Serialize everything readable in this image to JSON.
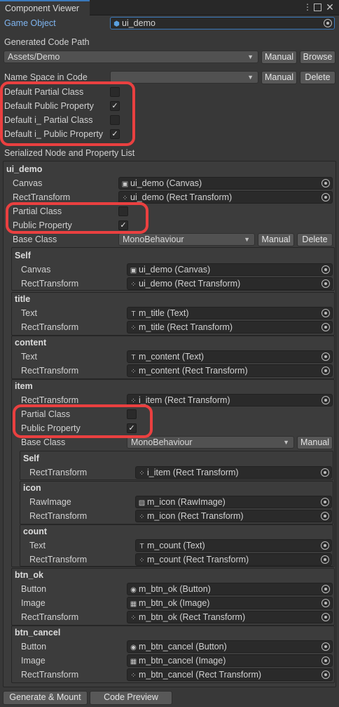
{
  "window": {
    "tab_title": "Component Viewer"
  },
  "game_object": {
    "label": "Game Object",
    "value": "ui_demo"
  },
  "code_path": {
    "label": "Generated Code Path",
    "value": "Assets/Demo",
    "manual": "Manual",
    "browse": "Browse"
  },
  "namespace": {
    "label": "Name Space in Code",
    "value": "",
    "manual": "Manual",
    "delete": "Delete"
  },
  "defaults": [
    {
      "label": "Default Partial Class",
      "checked": false
    },
    {
      "label": "Default Public Property",
      "checked": true
    },
    {
      "label": "Default i_ Partial Class",
      "checked": false
    },
    {
      "label": "Default i_ Public Property",
      "checked": true
    }
  ],
  "check_mark": "✓",
  "serialized_title": "Serialized Node and Property List",
  "root": {
    "name": "ui_demo",
    "canvas_label": "Canvas",
    "canvas_value": "ui_demo (Canvas)",
    "rect_label": "RectTransform",
    "rect_value": "ui_demo (Rect Transform)",
    "partial_label": "Partial Class",
    "public_label": "Public Property",
    "base_label": "Base Class",
    "base_value": "MonoBehaviour",
    "manual": "Manual",
    "delete": "Delete",
    "self": {
      "name": "Self",
      "canvas_label": "Canvas",
      "canvas_value": "ui_demo (Canvas)",
      "rect_label": "RectTransform",
      "rect_value": "ui_demo (Rect Transform)"
    },
    "title": {
      "name": "title",
      "text_label": "Text",
      "text_value": "m_title (Text)",
      "rect_label": "RectTransform",
      "rect_value": "m_title (Rect Transform)"
    },
    "content": {
      "name": "content",
      "text_label": "Text",
      "text_value": "m_content (Text)",
      "rect_label": "RectTransform",
      "rect_value": "m_content (Rect Transform)"
    },
    "item": {
      "name": "item",
      "rect_label": "RectTransform",
      "rect_value": "i_item (Rect Transform)",
      "partial_label": "Partial Class",
      "public_label": "Public Property",
      "base_label": "Base Class",
      "base_value": "MonoBehaviour",
      "manual": "Manual",
      "self": {
        "name": "Self",
        "rect_label": "RectTransform",
        "rect_value": "i_item (Rect Transform)"
      },
      "icon": {
        "name": "icon",
        "raw_label": "RawImage",
        "raw_value": "m_icon (RawImage)",
        "rect_label": "RectTransform",
        "rect_value": "m_icon (Rect Transform)"
      },
      "count": {
        "name": "count",
        "text_label": "Text",
        "text_value": "m_count (Text)",
        "rect_label": "RectTransform",
        "rect_value": "m_count (Rect Transform)"
      }
    },
    "btn_ok": {
      "name": "btn_ok",
      "button_label": "Button",
      "button_value": "m_btn_ok (Button)",
      "image_label": "Image",
      "image_value": "m_btn_ok (Image)",
      "rect_label": "RectTransform",
      "rect_value": "m_btn_ok (Rect Transform)"
    },
    "btn_cancel": {
      "name": "btn_cancel",
      "button_label": "Button",
      "button_value": "m_btn_cancel (Button)",
      "image_label": "Image",
      "image_value": "m_btn_cancel (Image)",
      "rect_label": "RectTransform",
      "rect_value": "m_btn_cancel (Rect Transform)"
    }
  },
  "footer": {
    "generate": "Generate & Mount",
    "preview": "Code Preview"
  },
  "colors": {
    "highlight": "#ea4040",
    "accent": "#3a79bb",
    "link": "#7fb5f0"
  }
}
